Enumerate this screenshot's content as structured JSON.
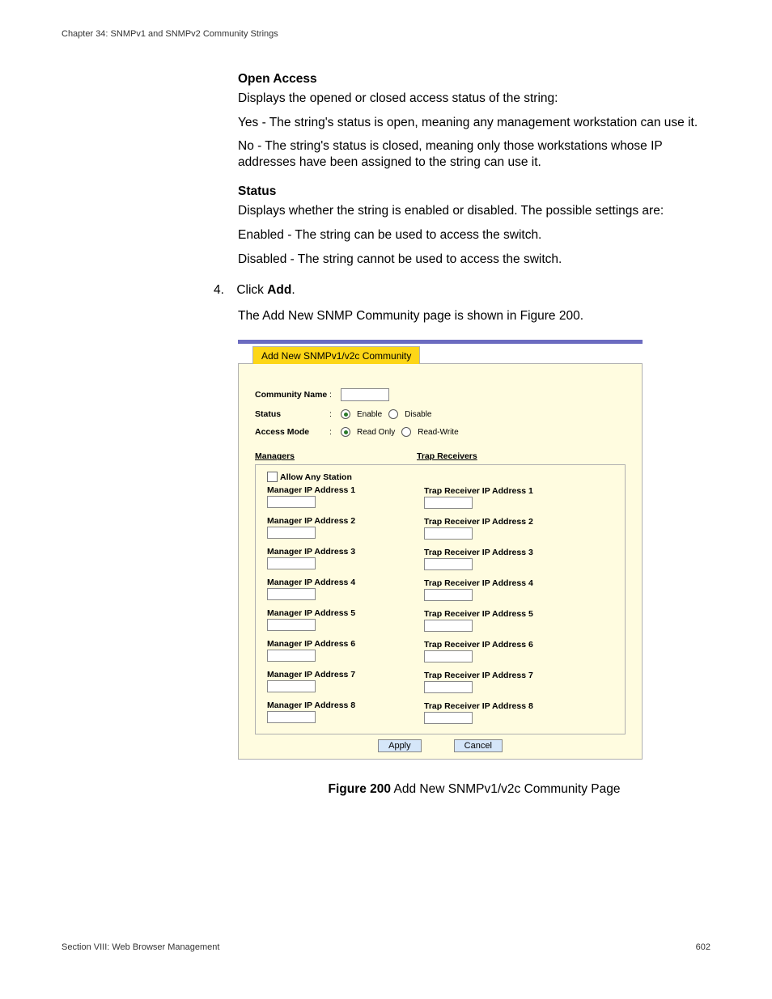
{
  "header": {
    "chapter": "Chapter 34: SNMPv1 and SNMPv2 Community Strings"
  },
  "body": {
    "open_access_label": "Open Access",
    "open_access_intro": "Displays the opened or closed access status of the string:",
    "open_access_yes": "Yes - The string's status is open, meaning any management workstation can use it.",
    "open_access_no": "No - The string's status is closed, meaning only those workstations whose IP addresses have been assigned to the string can use it.",
    "status_label": "Status",
    "status_intro": "Displays whether the string is enabled or disabled. The possible settings are:",
    "status_enabled": "Enabled - The string can be used to access the switch.",
    "status_disabled": "Disabled - The string cannot be used to access the switch.",
    "step_number": "4.",
    "step_click_prefix": "Click ",
    "step_click_bold": "Add",
    "step_click_suffix": ".",
    "step_following": "The Add New SNMP Community page is shown in Figure 200."
  },
  "ui": {
    "tab_title": "Add New SNMPv1/v2c Community",
    "community_name_label": "Community Name",
    "status_label": "Status",
    "status_enable": "Enable",
    "status_disable": "Disable",
    "access_mode_label": "Access Mode",
    "access_read_only": "Read Only",
    "access_read_write": "Read-Write",
    "managers_header": "Managers",
    "trap_header": "Trap Receivers",
    "allow_any": "Allow Any Station",
    "manager_prefix": "Manager IP Address ",
    "trap_prefix": "Trap Receiver IP Address ",
    "apply": "Apply",
    "cancel": "Cancel"
  },
  "figure": {
    "bold": "Figure 200",
    "rest": "  Add New SNMPv1/v2c Community Page"
  },
  "footer": {
    "section": "Section VIII: Web Browser Management",
    "page": "602"
  }
}
